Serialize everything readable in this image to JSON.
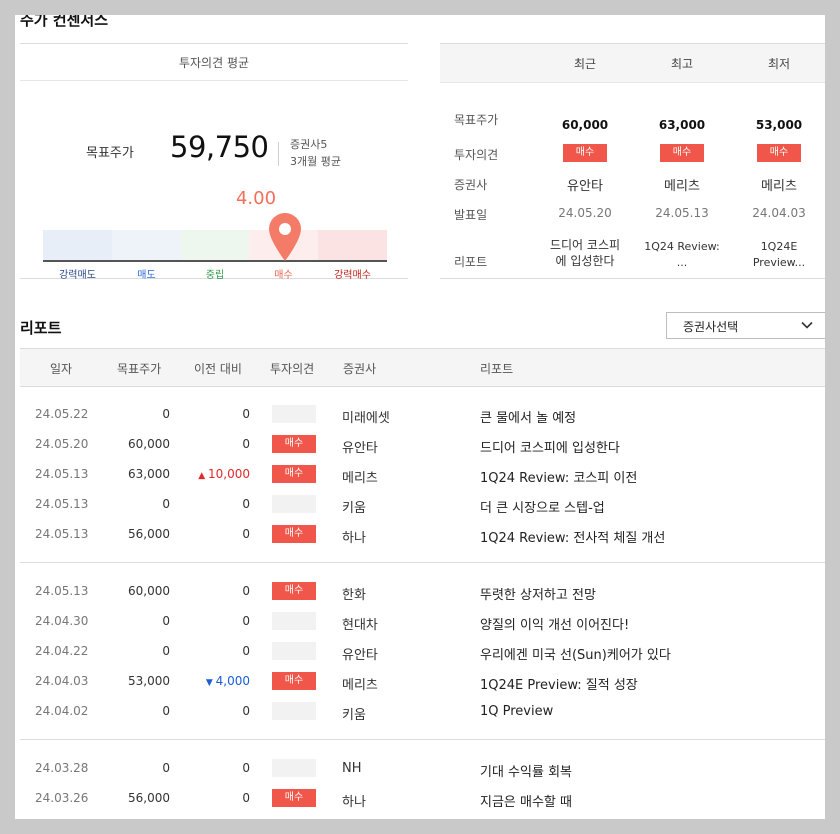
{
  "consensus": {
    "title": "주가 컨센서스",
    "caption": "투자의견 평균",
    "target_label": "목표주가",
    "target_value": "59,750",
    "broker_count": "증권사5",
    "period": "3개월 평균",
    "gauge_score": "4.00",
    "gauge_level": 4.0,
    "gauge_labels": [
      "강력매도",
      "매도",
      "중립",
      "매수",
      "강력매수"
    ],
    "gauge_colors": [
      "#e8eef8",
      "#eef3fa",
      "#edf7ee",
      "#fdeeed",
      "#fbe3e3"
    ],
    "gauge_label_colors": [
      "#2a4a8a",
      "#2c6bd6",
      "#2e9a47",
      "#e8664f",
      "#c0231b"
    ],
    "accent_color": "#f36f5b"
  },
  "consensus_table": {
    "columns": [
      "최근",
      "최고",
      "최저"
    ],
    "row_labels": [
      "목표주가",
      "투자의견",
      "증권사",
      "발표일",
      "리포트"
    ],
    "target_prices": [
      "60,000",
      "63,000",
      "53,000"
    ],
    "opinions": [
      "매수",
      "매수",
      "매수"
    ],
    "brokers": [
      "유안타",
      "메리츠",
      "메리츠"
    ],
    "dates": [
      "24.05.20",
      "24.05.13",
      "24.04.03"
    ],
    "reports": [
      [
        "드디어 코스피",
        "에 입성한다"
      ],
      [
        "1Q24 Review:",
        "..."
      ],
      [
        "1Q24E",
        "Preview..."
      ]
    ]
  },
  "reports": {
    "title": "리포트",
    "broker_select": "증권사선택",
    "headers": [
      "일자",
      "목표주가",
      "이전 대비",
      "투자의견",
      "증권사",
      "리포트"
    ],
    "rows": [
      {
        "date": "24.05.22",
        "target": "0",
        "diff": "0",
        "diff_dir": "",
        "opinion": "",
        "broker": "미래에셋",
        "report": "큰 물에서 놀 예정"
      },
      {
        "date": "24.05.20",
        "target": "60,000",
        "diff": "0",
        "diff_dir": "",
        "opinion": "매수",
        "broker": "유안타",
        "report": "드디어 코스피에 입성한다"
      },
      {
        "date": "24.05.13",
        "target": "63,000",
        "diff": "10,000",
        "diff_dir": "up",
        "opinion": "매수",
        "broker": "메리츠",
        "report": "1Q24 Review: 코스피 이전"
      },
      {
        "date": "24.05.13",
        "target": "0",
        "diff": "0",
        "diff_dir": "",
        "opinion": "",
        "broker": "키움",
        "report": "더 큰 시장으로 스텝-업"
      },
      {
        "date": "24.05.13",
        "target": "56,000",
        "diff": "0",
        "diff_dir": "",
        "opinion": "매수",
        "broker": "하나",
        "report": "1Q24 Review: 전사적 체질 개선"
      },
      {
        "date": "24.05.13",
        "target": "60,000",
        "diff": "0",
        "diff_dir": "",
        "opinion": "매수",
        "broker": "한화",
        "report": "뚜렷한 상저하고 전망"
      },
      {
        "date": "24.04.30",
        "target": "0",
        "diff": "0",
        "diff_dir": "",
        "opinion": "",
        "broker": "현대차",
        "report": "양질의 이익 개선 이어진다!"
      },
      {
        "date": "24.04.22",
        "target": "0",
        "diff": "0",
        "diff_dir": "",
        "opinion": "",
        "broker": "유안타",
        "report": "우리에겐 미국 선(Sun)케어가 있다"
      },
      {
        "date": "24.04.03",
        "target": "53,000",
        "diff": "4,000",
        "diff_dir": "down",
        "opinion": "매수",
        "broker": "메리츠",
        "report": "1Q24E Preview: 질적 성장"
      },
      {
        "date": "24.04.02",
        "target": "0",
        "diff": "0",
        "diff_dir": "",
        "opinion": "",
        "broker": "키움",
        "report": "1Q Preview"
      },
      {
        "date": "24.03.28",
        "target": "0",
        "diff": "0",
        "diff_dir": "",
        "opinion": "",
        "broker": "NH",
        "report": "기대 수익률 회복"
      },
      {
        "date": "24.03.26",
        "target": "56,000",
        "diff": "0",
        "diff_dir": "",
        "opinion": "매수",
        "broker": "하나",
        "report": "지금은 매수할 때"
      }
    ]
  }
}
